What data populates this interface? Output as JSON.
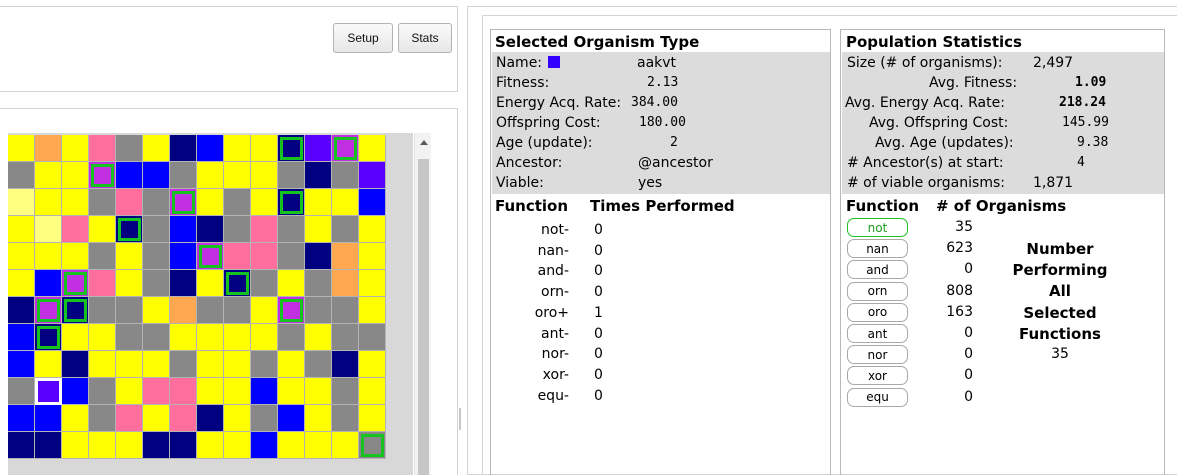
{
  "toolbar": {
    "setup_label": "Setup",
    "stats_label": "Stats"
  },
  "grid": {
    "palette": {
      "Y": "#ffff00",
      "G": "#888888",
      "N": "#000080",
      "B": "#0000ff",
      "P": "#ff6e9c",
      "O": "#ffa850",
      "L": "#ffff80",
      "V": "#5a00ff",
      "M": "#c030e0"
    },
    "rows": [
      "YOYPGYNBYYNVMY",
      "GYYMBBGYYYGNGV",
      "LYYGPGMYGYNYYB",
      "YLPYNGBNGPGYGY",
      "YYYGYGBMPPGNOY",
      "YBMPYGNYNGYGOY",
      "NMNGGYOGGYMGGY",
      "BNYYGGYYYYGYGG",
      "BYNYYYGYYGYGNY",
      "GVBGYPPYYBYYGY",
      "BBYGPYPNYGBYGY",
      "NNYYYNNYYBYYYG"
    ],
    "highlighted": [
      [
        0,
        10
      ],
      [
        0,
        12
      ],
      [
        1,
        3
      ],
      [
        2,
        6
      ],
      [
        2,
        10
      ],
      [
        3,
        4
      ],
      [
        4,
        7
      ],
      [
        5,
        2
      ],
      [
        5,
        8
      ],
      [
        6,
        1
      ],
      [
        6,
        2
      ],
      [
        6,
        10
      ],
      [
        7,
        1
      ],
      [
        11,
        13
      ]
    ],
    "selected": [
      9,
      1
    ]
  },
  "organism": {
    "title": "Selected Organism Type",
    "name_label": "Name:",
    "name_value": "aakvt",
    "name_color": "#3300ff",
    "fitness_label": "Fitness:",
    "fitness_value": "2.13",
    "energy_label": "Energy Acq. Rate:",
    "energy_value": "384.00",
    "offspring_label": "Offspring Cost:",
    "offspring_value": "180.00",
    "age_label": "Age (update):",
    "age_value": "2",
    "ancestor_label": "Ancestor:",
    "ancestor_value": "@ancestor",
    "viable_label": "Viable:",
    "viable_value": "yes",
    "function_header": "Function",
    "times_header": "Times Performed",
    "functions": [
      {
        "name": "not-",
        "times": "0"
      },
      {
        "name": "nan-",
        "times": "0"
      },
      {
        "name": "and-",
        "times": "0"
      },
      {
        "name": "orn-",
        "times": "0"
      },
      {
        "name": "oro+",
        "times": "1"
      },
      {
        "name": "ant-",
        "times": "0"
      },
      {
        "name": "nor-",
        "times": "0"
      },
      {
        "name": "xor-",
        "times": "0"
      },
      {
        "name": "equ-",
        "times": "0"
      }
    ]
  },
  "population": {
    "title": "Population Statistics",
    "size_label": "Size (# of organisms):",
    "size_value": "2,497",
    "avg_fitness_label": "Avg. Fitness:",
    "avg_fitness_value": "1.09",
    "avg_energy_label": "Avg. Energy Acq. Rate:",
    "avg_energy_value": "218.24",
    "avg_offspring_label": "Avg. Offspring Cost:",
    "avg_offspring_value": "145.99",
    "avg_age_label": "Avg. Age (updates):",
    "avg_age_value": "9.38",
    "ancestors_label": "# Ancestor(s) at start:",
    "ancestors_value": "4",
    "viable_label": "# of viable organisms:",
    "viable_value": "1,871",
    "function_header": "Function",
    "count_header": "# of Organisms",
    "functions": [
      {
        "name": "not",
        "count": "35",
        "active": true
      },
      {
        "name": "nan",
        "count": "623",
        "active": false
      },
      {
        "name": "and",
        "count": "0",
        "active": false
      },
      {
        "name": "orn",
        "count": "808",
        "active": false
      },
      {
        "name": "oro",
        "count": "163",
        "active": false
      },
      {
        "name": "ant",
        "count": "0",
        "active": false
      },
      {
        "name": "nor",
        "count": "0",
        "active": false
      },
      {
        "name": "xor",
        "count": "0",
        "active": false
      },
      {
        "name": "equ",
        "count": "0",
        "active": false
      }
    ],
    "side_lines": [
      "Number",
      "Performing",
      "All",
      "Selected",
      "Functions"
    ],
    "side_value": "35"
  }
}
